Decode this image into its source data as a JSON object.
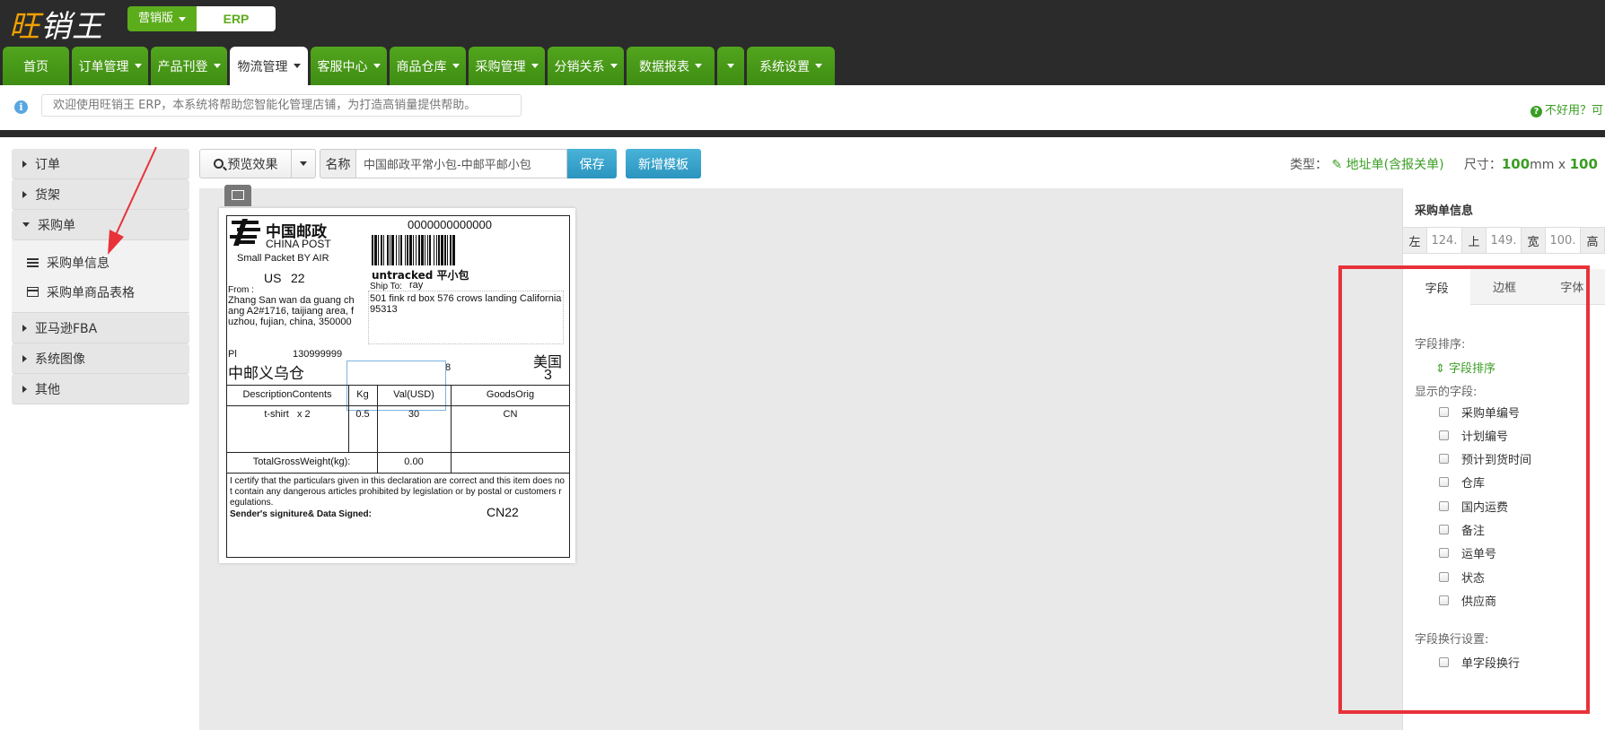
{
  "app": {
    "logo": "旺销王",
    "edition": "营销版",
    "product": "ERP"
  },
  "nav": [
    {
      "label": "首页",
      "dropdown": false,
      "active": false
    },
    {
      "label": "订单管理",
      "dropdown": true,
      "active": false
    },
    {
      "label": "产品刊登",
      "dropdown": true,
      "active": false
    },
    {
      "label": "物流管理",
      "dropdown": true,
      "active": true
    },
    {
      "label": "客服中心",
      "dropdown": true,
      "active": false
    },
    {
      "label": "商品仓库",
      "dropdown": true,
      "active": false
    },
    {
      "label": "采购管理",
      "dropdown": true,
      "active": false
    },
    {
      "label": "分销关系",
      "dropdown": true,
      "active": false
    },
    {
      "label": "数据报表",
      "dropdown": true,
      "active": false
    },
    {
      "label": "",
      "dropdown": true,
      "active": false
    },
    {
      "label": "系统设置",
      "dropdown": true,
      "active": false
    }
  ],
  "notice": {
    "message": "欢迎使用旺销王 ERP，本系统将帮助您智能化管理店铺，为打造高销量提供帮助。",
    "help": "不好用？可"
  },
  "sidebar": {
    "items": [
      "订单",
      "货架",
      "采购单",
      "亚马逊FBA",
      "系统图像",
      "其他"
    ],
    "expanded_sub": [
      "采购单信息",
      "采购单商品表格"
    ]
  },
  "toolbar": {
    "preview": "预览效果",
    "name_label": "名称",
    "name_value": "中国邮政平常小包-中邮平邮小包",
    "save": "保存",
    "new_template": "新增模板",
    "type_label": "类型：",
    "type_value": "地址单(含报关单)",
    "size_label": "尺寸：",
    "size_w": "100",
    "size_unit": "mm x",
    "size_h": "100"
  },
  "label": {
    "post_cn": "中国邮政",
    "post_en": "CHINA POST",
    "tracking": "0000000000000",
    "small_packet": "Small Packet BY AIR",
    "country_code": "US",
    "zone": "22",
    "service": "untracked 平小包",
    "from_label": "From :",
    "ship_to_label": "Ship To:",
    "ship_to_name": "ray",
    "from_address": "Zhang San wan da guang chang A2#1716, taijiang area, fuzhou, fujian, china, 350000",
    "to_address": "501 fink rd box 576 crows landing California 95313",
    "phone_label": "Pl",
    "phone": "130999999",
    "warehouse": "中邮义乌仓",
    "code_8": "8",
    "country_cn": "美国",
    "country_num": "3",
    "table_headers": [
      "DescriptionContents",
      "Kg",
      "Val(USD)",
      "GoodsOrig"
    ],
    "table_row": [
      "t-shirt   x 2",
      "0.5",
      "30",
      "CN"
    ],
    "total_label": "TotalGrossWeight(kg):",
    "total_value": "0.00",
    "certify": "I certify that the particulars given in this declaration are correct and this item does not contain any dangerous articles prohibited by legislation or by postal or customers regulations.",
    "signature": "Sender's signiture& Data Signed:",
    "cn22": "CN22"
  },
  "panel": {
    "title": "采购单信息",
    "pos": [
      {
        "label": "左",
        "value": "124."
      },
      {
        "label": "上",
        "value": "149."
      },
      {
        "label": "宽",
        "value": "100."
      },
      {
        "label": "高",
        "value": ""
      }
    ],
    "tabs": [
      "字段",
      "边框",
      "字体"
    ],
    "sort_label": "字段排序:",
    "sort_link": "字段排序",
    "shown_label": "显示的字段:",
    "fields": [
      "采购单编号",
      "计划编号",
      "预计到货时间",
      "仓库",
      "国内运费",
      "备注",
      "运单号",
      "状态",
      "供应商"
    ],
    "wrap_label": "字段换行设置:",
    "wrap_option": "单字段换行"
  },
  "colors": {
    "green": "#4a9b1a",
    "blue_button": "#2b95bf",
    "highlight": "#e8323a"
  }
}
